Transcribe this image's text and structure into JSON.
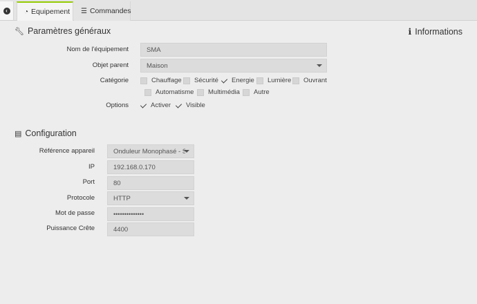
{
  "tabs": {
    "equipement": "Equipement",
    "commandes": "Commandes"
  },
  "general": {
    "title": "Paramètres généraux",
    "info_title": "Informations",
    "name_label": "Nom de l'équipement",
    "name_value": "SMA",
    "parent_label": "Objet parent",
    "parent_value": "Maison",
    "category_label": "Catégorie",
    "categories": [
      {
        "label": "Chauffage",
        "checked": false
      },
      {
        "label": "Sécurité",
        "checked": false
      },
      {
        "label": "Energie",
        "checked": true
      },
      {
        "label": "Lumière",
        "checked": false
      },
      {
        "label": "Ouvrant",
        "checked": false
      },
      {
        "label": "Automatisme",
        "checked": false
      },
      {
        "label": "Multimédia",
        "checked": false
      },
      {
        "label": "Autre",
        "checked": false
      }
    ],
    "options_label": "Options",
    "options": [
      {
        "label": "Activer",
        "checked": true
      },
      {
        "label": "Visible",
        "checked": true
      }
    ]
  },
  "config": {
    "title": "Configuration",
    "ref_label": "Référence appareil",
    "ref_value": "Onduleur Monophasé - S",
    "ip_label": "IP",
    "ip_value": "192.168.0.170",
    "port_label": "Port",
    "port_value": "80",
    "protocol_label": "Protocole",
    "protocol_value": "HTTP",
    "password_label": "Mot de passe",
    "password_value": "••••••••••••••",
    "power_label": "Puissance Crête",
    "power_value": "4400"
  },
  "icons": {
    "back": "arrow-circle-left-icon",
    "equipement": "tachometer-icon",
    "commandes": "list-icon",
    "general": "wrench-icon",
    "info": "info-icon",
    "config": "list-alt-icon"
  },
  "colors": {
    "accent": "#94ca02"
  }
}
